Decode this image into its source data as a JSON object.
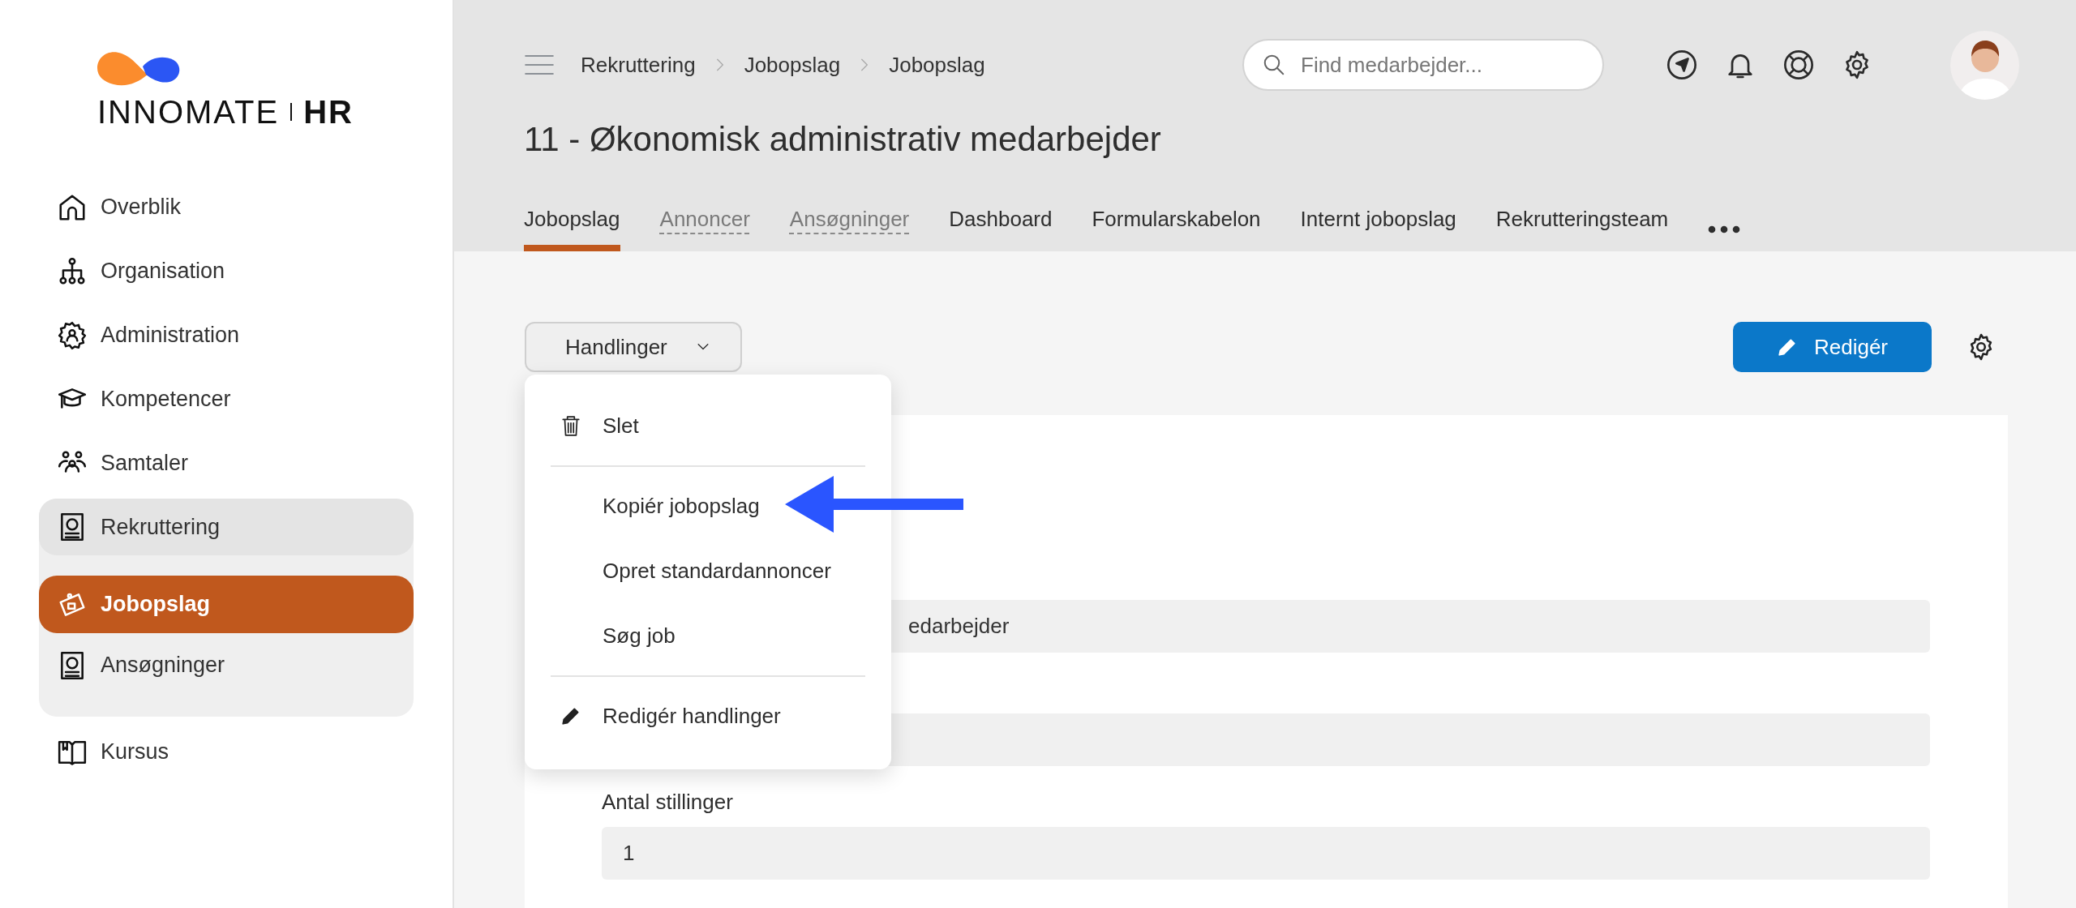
{
  "logo": {
    "light": "INNO",
    "strong": "MATE",
    "product": "HR"
  },
  "sidebar": {
    "items": [
      {
        "label": "Overblik",
        "selected": false
      },
      {
        "label": "Organisation",
        "selected": false
      },
      {
        "label": "Administration",
        "selected": false
      },
      {
        "label": "Kompetencer",
        "selected": false
      },
      {
        "label": "Samtaler",
        "selected": false
      },
      {
        "label": "Rekruttering",
        "selected": false,
        "expanded": true,
        "children": [
          {
            "label": "Jobopslag",
            "selected": true
          },
          {
            "label": "Ansøgninger",
            "selected": false
          }
        ]
      },
      {
        "label": "Kursus",
        "selected": false
      }
    ]
  },
  "header": {
    "breadcrumb": [
      "Rekruttering",
      "Jobopslag",
      "Jobopslag"
    ],
    "search": {
      "placeholder": "Find medarbejder..."
    },
    "title": "11 - Økonomisk administrativ medarbejder",
    "tabs": [
      {
        "label": "Jobopslag",
        "selected": true,
        "disabled": false
      },
      {
        "label": "Annoncer",
        "selected": false,
        "disabled": true
      },
      {
        "label": "Ansøgninger",
        "selected": false,
        "disabled": true
      },
      {
        "label": "Dashboard",
        "selected": false,
        "disabled": false
      },
      {
        "label": "Formularskabelon",
        "selected": false,
        "disabled": false
      },
      {
        "label": "Internt jobopslag",
        "selected": false,
        "disabled": false
      },
      {
        "label": "Rekrutteringsteam",
        "selected": false,
        "disabled": false
      }
    ]
  },
  "actions": {
    "label": "Handlinger",
    "expanded": true,
    "menu_groups": [
      [
        {
          "label": "Slet",
          "kind": "delete"
        }
      ],
      [
        {
          "label": "Kopiér jobopslag",
          "kind": "plain"
        },
        {
          "label": "Opret standardannoncer",
          "kind": "plain"
        },
        {
          "label": "Søg job",
          "kind": "plain"
        }
      ],
      [
        {
          "label": "Redigér handlinger",
          "kind": "edit"
        }
      ]
    ]
  },
  "edit_button": {
    "label": "Redigér"
  },
  "form": {
    "fields": [
      {
        "kind": "input",
        "value": "edarbejder"
      },
      {
        "kind": "input"
      },
      {
        "kind": "input",
        "label": "Antal stillinger",
        "value": "1"
      }
    ]
  }
}
